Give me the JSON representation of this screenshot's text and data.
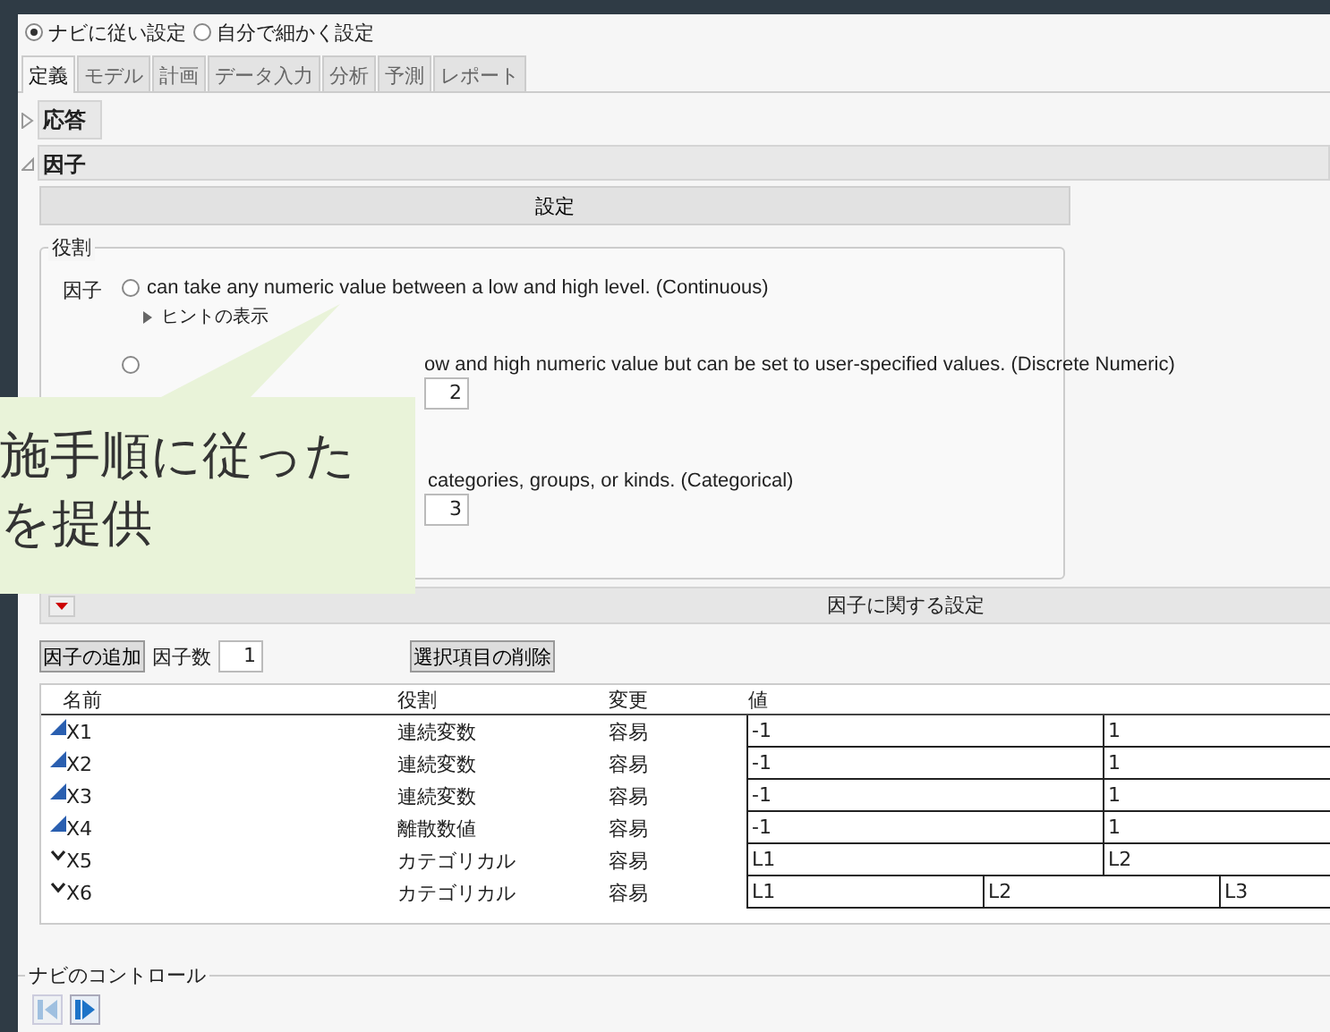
{
  "mode_options": [
    {
      "label": "ナビに従い設定",
      "selected": true
    },
    {
      "label": "自分で細かく設定",
      "selected": false
    }
  ],
  "tabs": [
    {
      "label": "定義",
      "selected": true
    },
    {
      "label": "モデル",
      "selected": false
    },
    {
      "label": "計画",
      "selected": false
    },
    {
      "label": "データ入力",
      "selected": false
    },
    {
      "label": "分析",
      "selected": false
    },
    {
      "label": "予測",
      "selected": false
    },
    {
      "label": "レポート",
      "selected": false
    }
  ],
  "response_section": {
    "title": "応答",
    "expanded": false
  },
  "factor_section": {
    "title": "因子",
    "expanded": true
  },
  "settings_button": "設定",
  "role_group": {
    "legend": "役割",
    "factor_label": "因子",
    "options": [
      {
        "text": "can take any numeric value between a low and high level. (Continuous)",
        "selected": false,
        "hint": "ヒントの表示"
      },
      {
        "text": "ow and high numeric value but can be set to user-specified values. (Discrete Numeric)",
        "selected": false,
        "count": "2"
      },
      {
        "text": "categories, groups, or kinds. (Categorical)",
        "count": "3"
      }
    ]
  },
  "callout": {
    "lines": [
      "施手順に従った",
      "を提供"
    ]
  },
  "factor_settings": {
    "title": "因子に関する設定",
    "add_button": "因子の追加",
    "count_label": "因子数",
    "count": "1",
    "delete_button": "選択項目の削除",
    "columns": [
      "名前",
      "役割",
      "変更",
      "値"
    ],
    "rows": [
      {
        "name": "X1",
        "kind": "continuous",
        "role": "連続変数",
        "change": "容易",
        "values": [
          "-1",
          "1"
        ]
      },
      {
        "name": "X2",
        "kind": "continuous",
        "role": "連続変数",
        "change": "容易",
        "values": [
          "-1",
          "1"
        ]
      },
      {
        "name": "X3",
        "kind": "continuous",
        "role": "連続変数",
        "change": "容易",
        "values": [
          "-1",
          "1"
        ]
      },
      {
        "name": "X4",
        "kind": "continuous",
        "role": "離散数値",
        "change": "容易",
        "values": [
          "-1",
          "1"
        ]
      },
      {
        "name": "X5",
        "kind": "categorical",
        "role": "カテゴリカル",
        "change": "容易",
        "values": [
          "L1",
          "L2"
        ]
      },
      {
        "name": "X6",
        "kind": "categorical",
        "role": "カテゴリカル",
        "change": "容易",
        "values": [
          "L1",
          "L2",
          "L3"
        ]
      }
    ]
  },
  "navi_controls": {
    "legend": "ナビのコントロール",
    "back_disabled": true,
    "next_disabled": false
  }
}
